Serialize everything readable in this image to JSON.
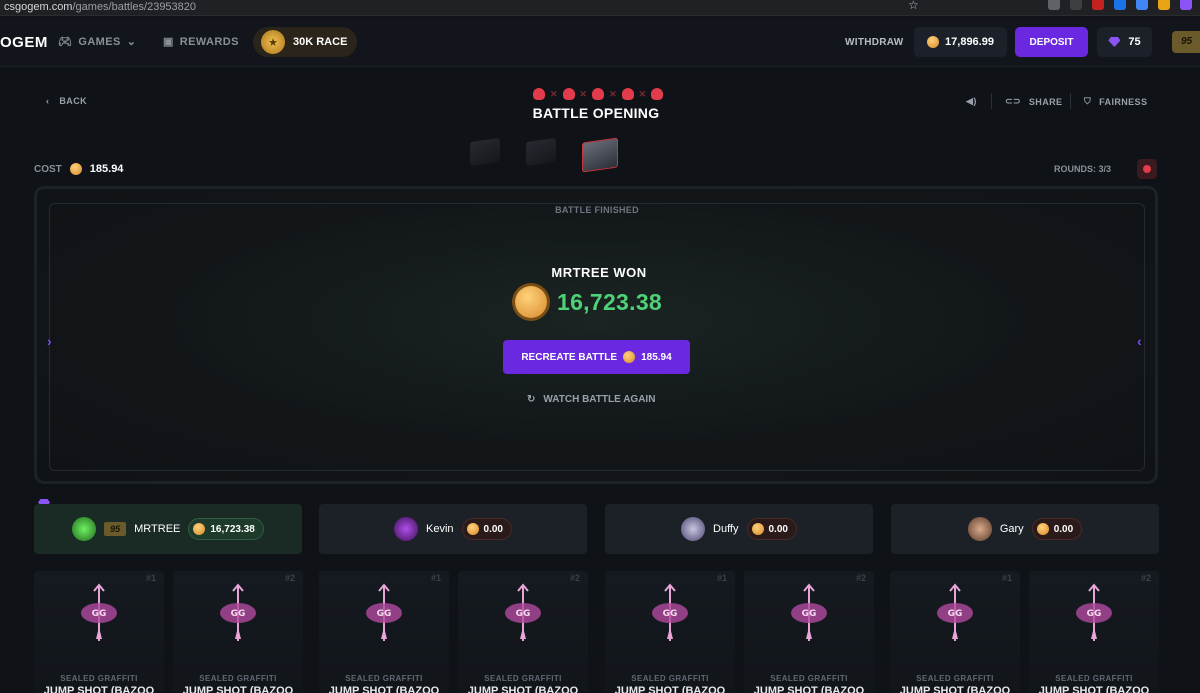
{
  "browser": {
    "url_host": "csgogem.com",
    "url_path": "/games/battles/23953820"
  },
  "header": {
    "logo": "OGEM",
    "nav": [
      {
        "label": "GAMES",
        "icon": "gamepad-icon"
      },
      {
        "label": "REWARDS",
        "icon": "gift-icon"
      }
    ],
    "race_label": "30K RACE",
    "withdraw_label": "WITHDRAW",
    "balance": "17,896.99",
    "deposit_label": "DEPOSIT",
    "gems": "75",
    "level": "95"
  },
  "battle": {
    "back_label": "BACK",
    "title": "BATTLE OPENING",
    "share_label": "SHARE",
    "fairness_label": "FAIRNESS",
    "cost_label": "COST",
    "cost_value": "185.94",
    "rounds": "ROUNDS: 3/3",
    "status": "BATTLE FINISHED",
    "winner_text": "MRTREE WON",
    "winnings": "16,723.38",
    "recreate_label": "RECREATE BATTLE",
    "recreate_cost": "185.94",
    "watch_again_label": "WATCH BATTLE AGAIN"
  },
  "players": [
    {
      "name": "MRTREE",
      "level": "95",
      "total": "16,723.38",
      "winner": true
    },
    {
      "name": "Kevin",
      "total": "0.00",
      "winner": false
    },
    {
      "name": "Duffy",
      "total": "0.00",
      "winner": false
    },
    {
      "name": "Gary",
      "total": "0.00",
      "winner": false
    }
  ],
  "items": [
    {
      "num": "#1",
      "category": "SEALED GRAFFITI",
      "name": "JUMP SHOT (BAZOO"
    },
    {
      "num": "#2",
      "category": "SEALED GRAFFITI",
      "name": "JUMP SHOT (BAZOO"
    },
    {
      "num": "#1",
      "category": "SEALED GRAFFITI",
      "name": "JUMP SHOT (BAZOO"
    },
    {
      "num": "#2",
      "category": "SEALED GRAFFITI",
      "name": "JUMP SHOT (BAZOO"
    },
    {
      "num": "#1",
      "category": "SEALED GRAFFITI",
      "name": "JUMP SHOT (BAZOO"
    },
    {
      "num": "#2",
      "category": "SEALED GRAFFITI",
      "name": "JUMP SHOT (BAZOO"
    },
    {
      "num": "#1",
      "category": "SEALED GRAFFITI",
      "name": "JUMP SHOT (BAZOO"
    },
    {
      "num": "#2",
      "category": "SEALED GRAFFITI",
      "name": "JUMP SHOT (BAZOO"
    }
  ],
  "colors": {
    "accent": "#6a29e0",
    "win_green": "#4fd178",
    "skull_red": "#e23b4b",
    "background": "#0f1217"
  }
}
